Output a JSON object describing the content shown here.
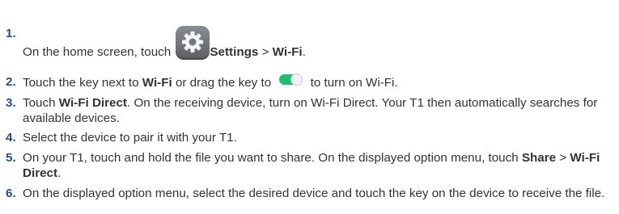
{
  "steps": [
    {
      "number": "1.",
      "text_before": "On the home screen, touch ",
      "icon": "settings-gear-icon",
      "bold_1": "Settings",
      "sep": " > ",
      "bold_2": "Wi-Fi",
      "end": "."
    },
    {
      "number": "2.",
      "text_before": "Touch the key next to ",
      "bold_1": "Wi-Fi",
      "text_middle": " or drag the key to ",
      "icon": "toggle-switch-on-icon",
      "text_after": " to turn on Wi-Fi."
    },
    {
      "number": "3.",
      "text_before": "Touch ",
      "bold_1": "Wi-Fi Direct",
      "text_after": ". On the receiving device, turn on Wi-Fi Direct. Your T1 then automatically searches for available devices."
    },
    {
      "number": "4.",
      "text": "Select the device to pair it with your T1."
    },
    {
      "number": "5.",
      "text_before": "On your T1, touch and hold the file you want to share. On the displayed option menu, touch ",
      "bold_1": "Share",
      "sep": " > ",
      "bold_2": "Wi-Fi Direct",
      "end": "."
    },
    {
      "number": "6.",
      "text": "On the displayed option menu, select the desired device and touch the key on the device to receive the file."
    }
  ],
  "colors": {
    "number": "#2a4f88",
    "text": "#333333",
    "toggle_on": "#1dbf75",
    "settings_icon": "#6e7175"
  }
}
